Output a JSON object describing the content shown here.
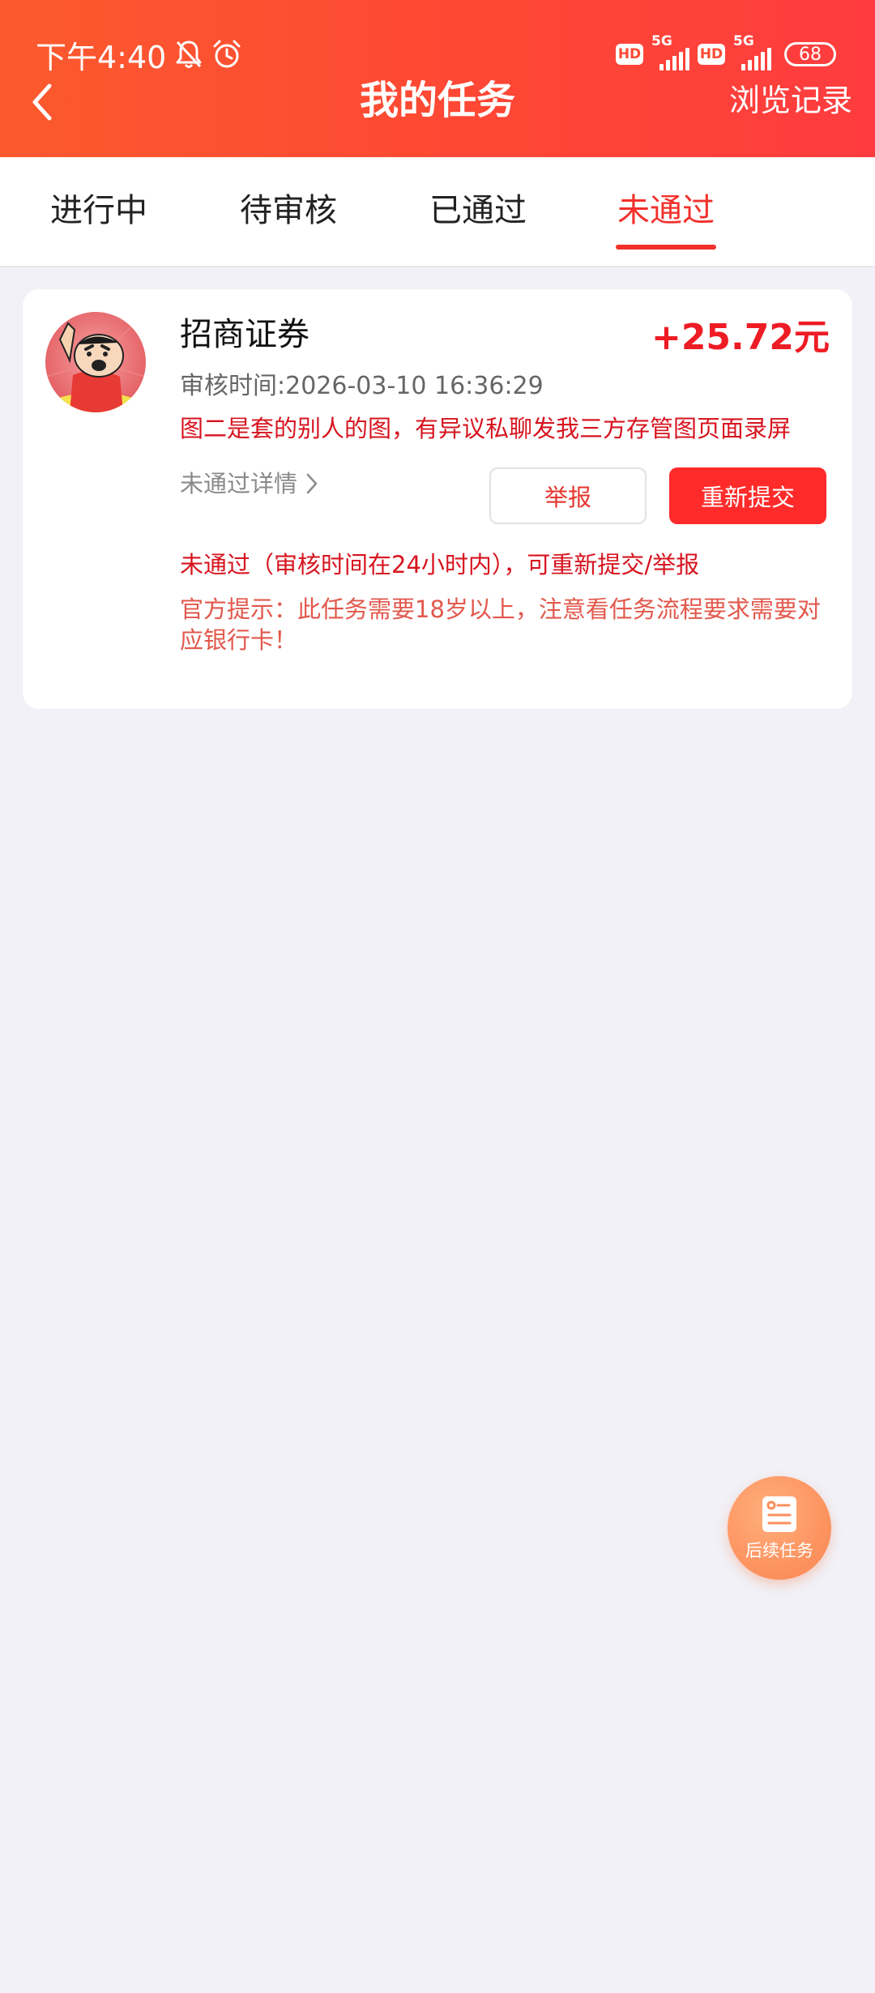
{
  "status_bar": {
    "time": "下午4:40",
    "network_1": "5G",
    "network_2": "5G",
    "hd_1": "HD",
    "hd_2": "HD",
    "battery": "68",
    "icons": [
      "mute-bell-icon",
      "alarm-icon",
      "signal-icon",
      "battery-icon"
    ]
  },
  "header": {
    "title": "我的任务",
    "right_link": "浏览记录",
    "gradient_colors": [
      "#fb5a2e",
      "#fe3c3f"
    ]
  },
  "tabs": [
    {
      "label": "进行中",
      "active": false
    },
    {
      "label": "待审核",
      "active": false
    },
    {
      "label": "已通过",
      "active": false
    },
    {
      "label": "未通过",
      "active": true
    }
  ],
  "task": {
    "title": "招商证券",
    "reward": "+25.72元",
    "review_time": "审核时间:2026-03-10 16:36:29",
    "reject_reason": "图二是套的别人的图，有异议私聊发我三方存管图页面录屏",
    "detail_link": "未通过详情",
    "report_button": "举报",
    "resubmit_button": "重新提交",
    "status_note": "未通过（审核时间在24小时内），可重新提交/举报",
    "official_tip": "官方提示：此任务需要18岁以上，注意看任务流程要求需要对应银行卡！"
  },
  "fab": {
    "label": "后续任务",
    "icon": "document-icon"
  },
  "colors": {
    "accent_red": "#f2312c",
    "reward_red": "#ee1c25",
    "page_bg": "#f1f1f7",
    "fab_orange": "#fd9460"
  }
}
